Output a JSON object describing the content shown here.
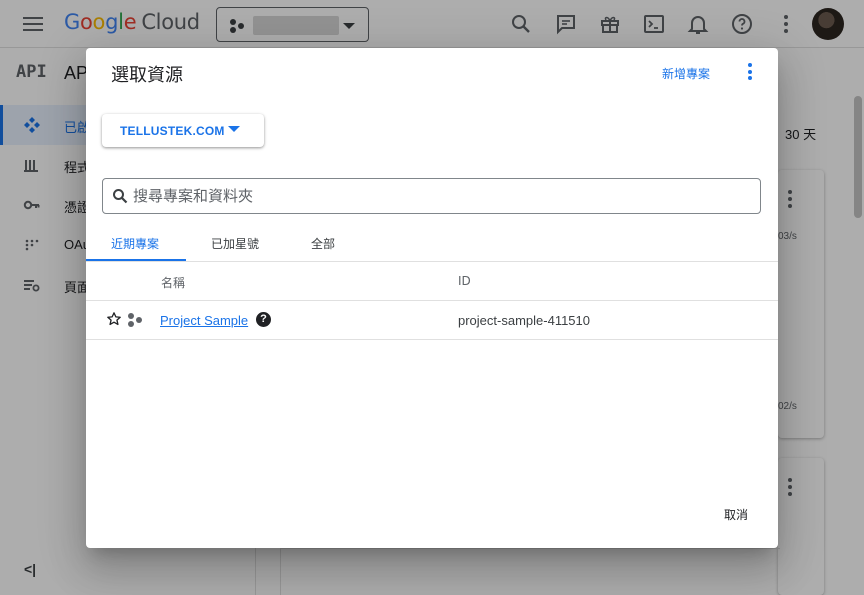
{
  "topbar": {
    "logo_letters": [
      "G",
      "o",
      "o",
      "g",
      "l",
      "e"
    ],
    "logo_suffix": "Cloud",
    "project_picker_icon": "project-dots-icon",
    "icons": [
      "search-icon",
      "feedback-icon",
      "gift-icon",
      "cloud-shell-icon",
      "bell-icon",
      "help-icon",
      "more-vert-icon"
    ]
  },
  "sidebar": {
    "logo": "API",
    "title": "AP",
    "items": [
      {
        "label": "已啟",
        "icon": "dashboard-icon",
        "active": true
      },
      {
        "label": "程式",
        "icon": "library-icon",
        "active": false
      },
      {
        "label": "憑證",
        "icon": "key-icon",
        "active": false
      },
      {
        "label": "OAu",
        "icon": "consent-icon",
        "active": false
      },
      {
        "label": "頁面",
        "icon": "settings-list-icon",
        "active": false
      }
    ],
    "collapse_label": "<|"
  },
  "background": {
    "days_label": "30 天",
    "rate_1": "03/s",
    "rate_2": "02/s"
  },
  "dialog": {
    "title": "選取資源",
    "new_project_label": "新增專案",
    "org_label": "TELLUSTEK.COM",
    "search_placeholder": "搜尋專案和資料夾",
    "tabs": [
      {
        "label": "近期專案",
        "active": true
      },
      {
        "label": "已加星號",
        "active": false
      },
      {
        "label": "全部",
        "active": false
      }
    ],
    "columns": {
      "name": "名稱",
      "id": "ID"
    },
    "rows": [
      {
        "name": "Project Sample",
        "id": "project-sample-411510",
        "starred": false
      }
    ],
    "cancel_label": "取消"
  },
  "colors": {
    "accent": "#1a73e8",
    "scrim": "rgba(0,0,0,0.32)"
  }
}
